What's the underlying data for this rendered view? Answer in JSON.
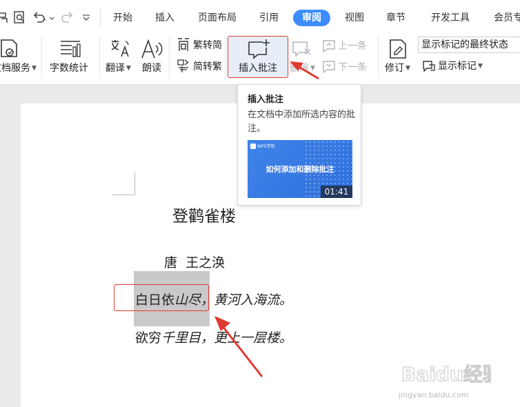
{
  "menu": {
    "tabs": [
      {
        "label": "开始"
      },
      {
        "label": "插入"
      },
      {
        "label": "页面布局"
      },
      {
        "label": "引用"
      },
      {
        "label": "审阅"
      },
      {
        "label": "视图"
      },
      {
        "label": "章节"
      },
      {
        "label": "开发工具"
      },
      {
        "label": "会员专"
      }
    ],
    "active_tab": "审阅"
  },
  "ribbon": {
    "doc_service": "文档服务",
    "word_count": "字数统计",
    "translate": "翻译",
    "read_aloud": "朗读",
    "trad_to_simp": "繁转简",
    "simp_to_trad": "简转繁",
    "insert_comment": "插入批注",
    "delete": "删除",
    "prev": "上一条",
    "next": "下一条",
    "revise": "修订",
    "markup_select": "显示标记的最终状态",
    "show_markup": "显示标记"
  },
  "tooltip": {
    "title": "插入批注",
    "description": "在文档中添加所选内容的批注。",
    "video_brand": "WPS学院",
    "video_title": "如何添加和删除批注",
    "video_duration": "01:41"
  },
  "document": {
    "title": "登鹳雀楼",
    "author": "唐  王之涣",
    "line1_normal": "白日依",
    "line1_italic": "山尽，黄河入海流。",
    "line2_normal": "欲穷",
    "line2_italic": "千里目，更上一层楼。"
  },
  "watermark": {
    "main": "Baidu经验",
    "sub": "jingyan.baidu.com"
  },
  "colors": {
    "accent": "#3c8cff",
    "annotation_red": "#e03a2f",
    "selection_gray": "#c9c9c9"
  }
}
